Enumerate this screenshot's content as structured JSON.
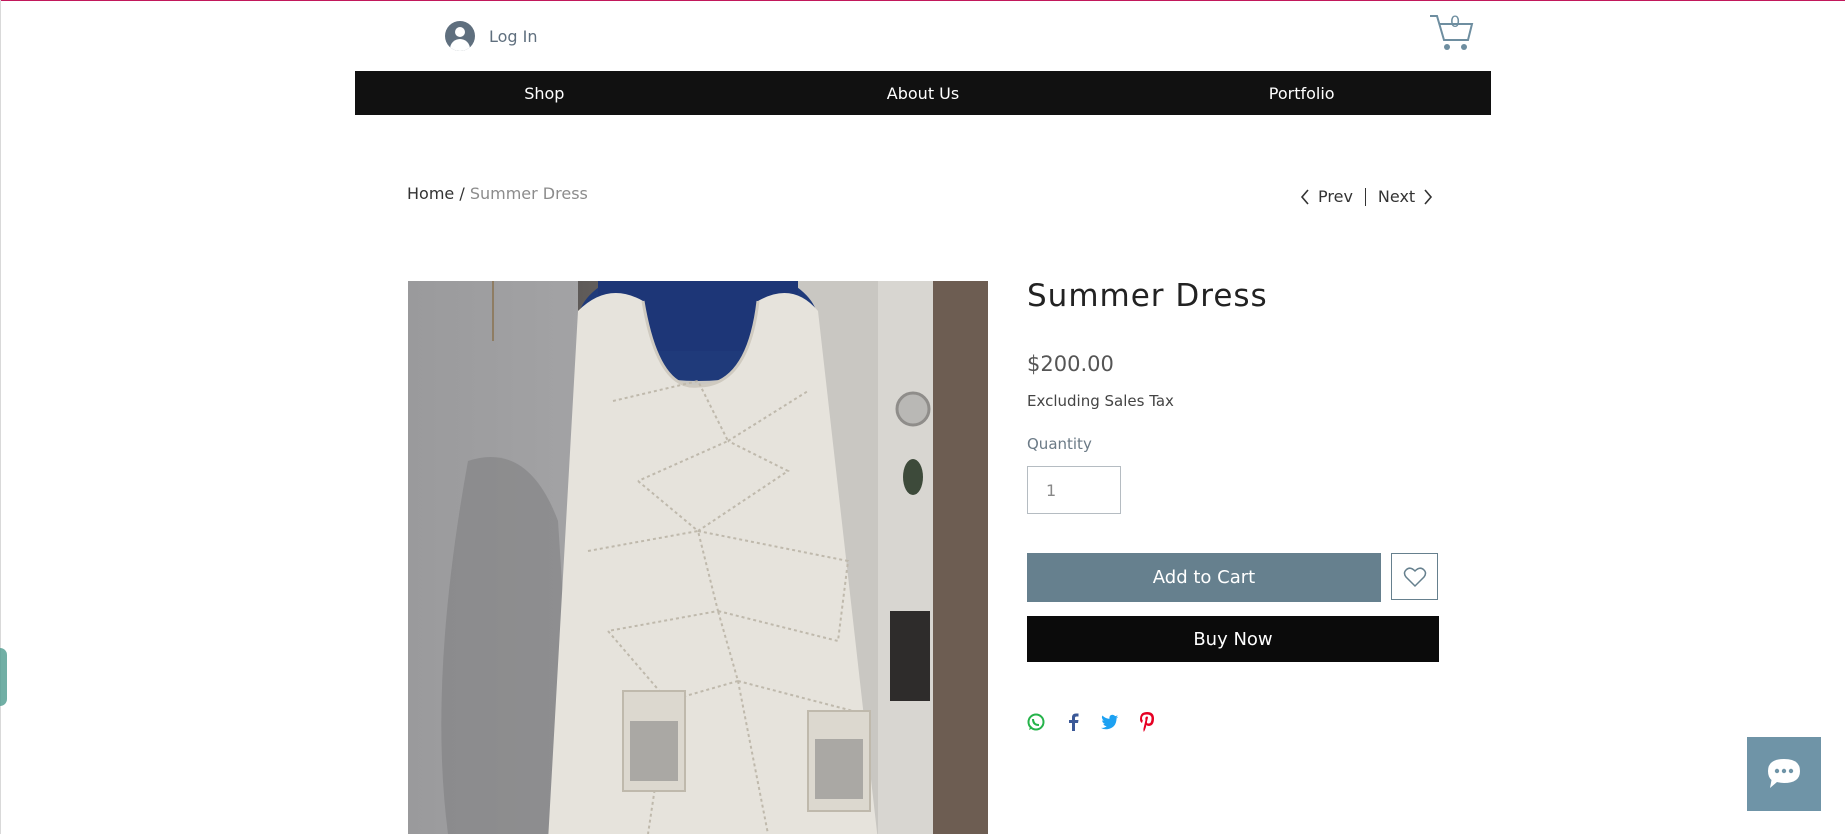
{
  "header": {
    "login_label": "Log In",
    "cart_count": "0"
  },
  "nav": {
    "items": [
      {
        "label": "Shop"
      },
      {
        "label": "About Us"
      },
      {
        "label": "Portfolio"
      }
    ]
  },
  "breadcrumb": {
    "home": "Home",
    "separator": "/",
    "current": "Summer Dress"
  },
  "pager": {
    "prev": "Prev",
    "next": "Next"
  },
  "product": {
    "title": "Summer Dress",
    "price": "$200.00",
    "tax_note": "Excluding Sales Tax",
    "quantity_label": "Quantity",
    "quantity_value": "1",
    "add_to_cart": "Add to Cart",
    "buy_now": "Buy Now"
  },
  "share": {
    "icons": [
      "whatsapp-icon",
      "facebook-icon",
      "twitter-icon",
      "pinterest-icon"
    ]
  },
  "colors": {
    "accent": "#66808e",
    "nav_bg": "#111111",
    "buy_now_bg": "#0b0b0b",
    "chat_bg": "#6f94a7",
    "top_border": "#c2185b"
  }
}
